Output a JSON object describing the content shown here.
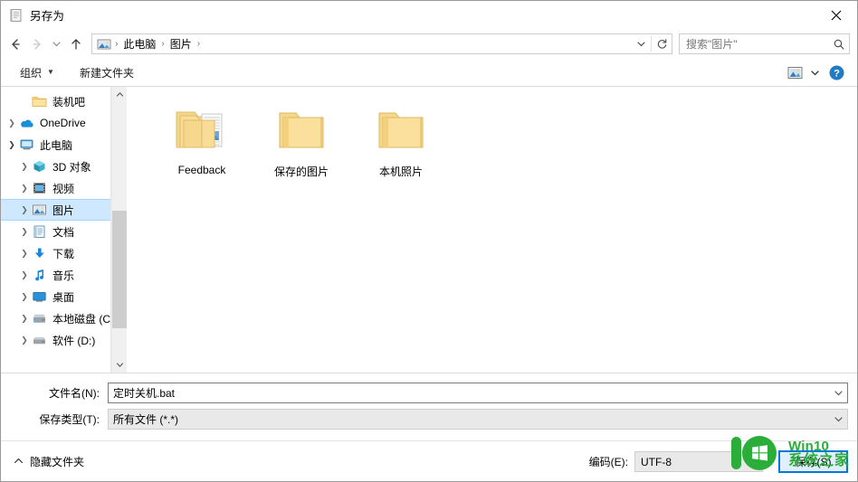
{
  "window": {
    "title": "另存为",
    "title_icon": "notepad-icon",
    "close_label": "✕"
  },
  "nav": {
    "back": "←",
    "forward": "→",
    "recent": "⌄",
    "up": "↑",
    "breadcrumb": {
      "icon": "pictures-folder-icon",
      "items": [
        "此电脑",
        "图片"
      ],
      "separator": "›",
      "trailing_separator": "›"
    },
    "address_dropdown": "⌄",
    "refresh": "↻"
  },
  "search": {
    "placeholder": "搜索\"图片\"",
    "value": "",
    "icon": "search-icon"
  },
  "toolbar": {
    "organize_label": "组织",
    "organize_caret": "▼",
    "new_folder_label": "新建文件夹",
    "view_icon": "view-mode-icon",
    "view_caret": "▼",
    "help_label": "?"
  },
  "sidebar": {
    "scroll_up": "⌃",
    "scroll_down": "⌄",
    "items": [
      {
        "label": "装机吧",
        "icon": "folder-icon",
        "indent": 2,
        "twisty": "none",
        "selected": false
      },
      {
        "label": "OneDrive",
        "icon": "onedrive-icon",
        "indent": 1,
        "twisty": "collapsed",
        "selected": false
      },
      {
        "label": "此电脑",
        "icon": "this-pc-icon",
        "indent": 1,
        "twisty": "expanded",
        "selected": false
      },
      {
        "label": "3D 对象",
        "icon": "3d-objects-icon",
        "indent": 2,
        "twisty": "collapsed",
        "selected": false
      },
      {
        "label": "视频",
        "icon": "videos-icon",
        "indent": 2,
        "twisty": "collapsed",
        "selected": false
      },
      {
        "label": "图片",
        "icon": "pictures-icon",
        "indent": 2,
        "twisty": "collapsed",
        "selected": true
      },
      {
        "label": "文档",
        "icon": "documents-icon",
        "indent": 2,
        "twisty": "collapsed",
        "selected": false
      },
      {
        "label": "下载",
        "icon": "downloads-icon",
        "indent": 2,
        "twisty": "collapsed",
        "selected": false
      },
      {
        "label": "音乐",
        "icon": "music-icon",
        "indent": 2,
        "twisty": "collapsed",
        "selected": false
      },
      {
        "label": "桌面",
        "icon": "desktop-icon",
        "indent": 2,
        "twisty": "collapsed",
        "selected": false
      },
      {
        "label": "本地磁盘 (C:)",
        "icon": "local-disk-icon",
        "indent": 2,
        "twisty": "collapsed",
        "selected": false
      },
      {
        "label": "软件 (D:)",
        "icon": "drive-icon",
        "indent": 2,
        "twisty": "collapsed",
        "selected": false
      }
    ]
  },
  "files": [
    {
      "name": "Feedback",
      "icon": "folder-with-contents-icon"
    },
    {
      "name": "保存的图片",
      "icon": "folder-icon"
    },
    {
      "name": "本机照片",
      "icon": "folder-icon"
    }
  ],
  "form": {
    "filename_label": "文件名(N):",
    "filename_value": "定时关机.bat",
    "filetype_label": "保存类型(T):",
    "filetype_value": "所有文件  (*.*)",
    "chevron": "⌄"
  },
  "footer": {
    "hide_folders_label": "隐藏文件夹",
    "hide_folders_chevron": "⌃",
    "encoding_label": "编码(E):",
    "encoding_value": "UTF-8",
    "encoding_chevron": "⌄",
    "save_label": "保存(S)"
  },
  "watermark": {
    "line1": "Win10",
    "line2": "系统之家",
    "color": "#2bad3a"
  },
  "colors": {
    "accent": "#0078d7",
    "selection": "#cde8ff",
    "hover": "#e5f3ff",
    "folder": "#f6d88d"
  }
}
